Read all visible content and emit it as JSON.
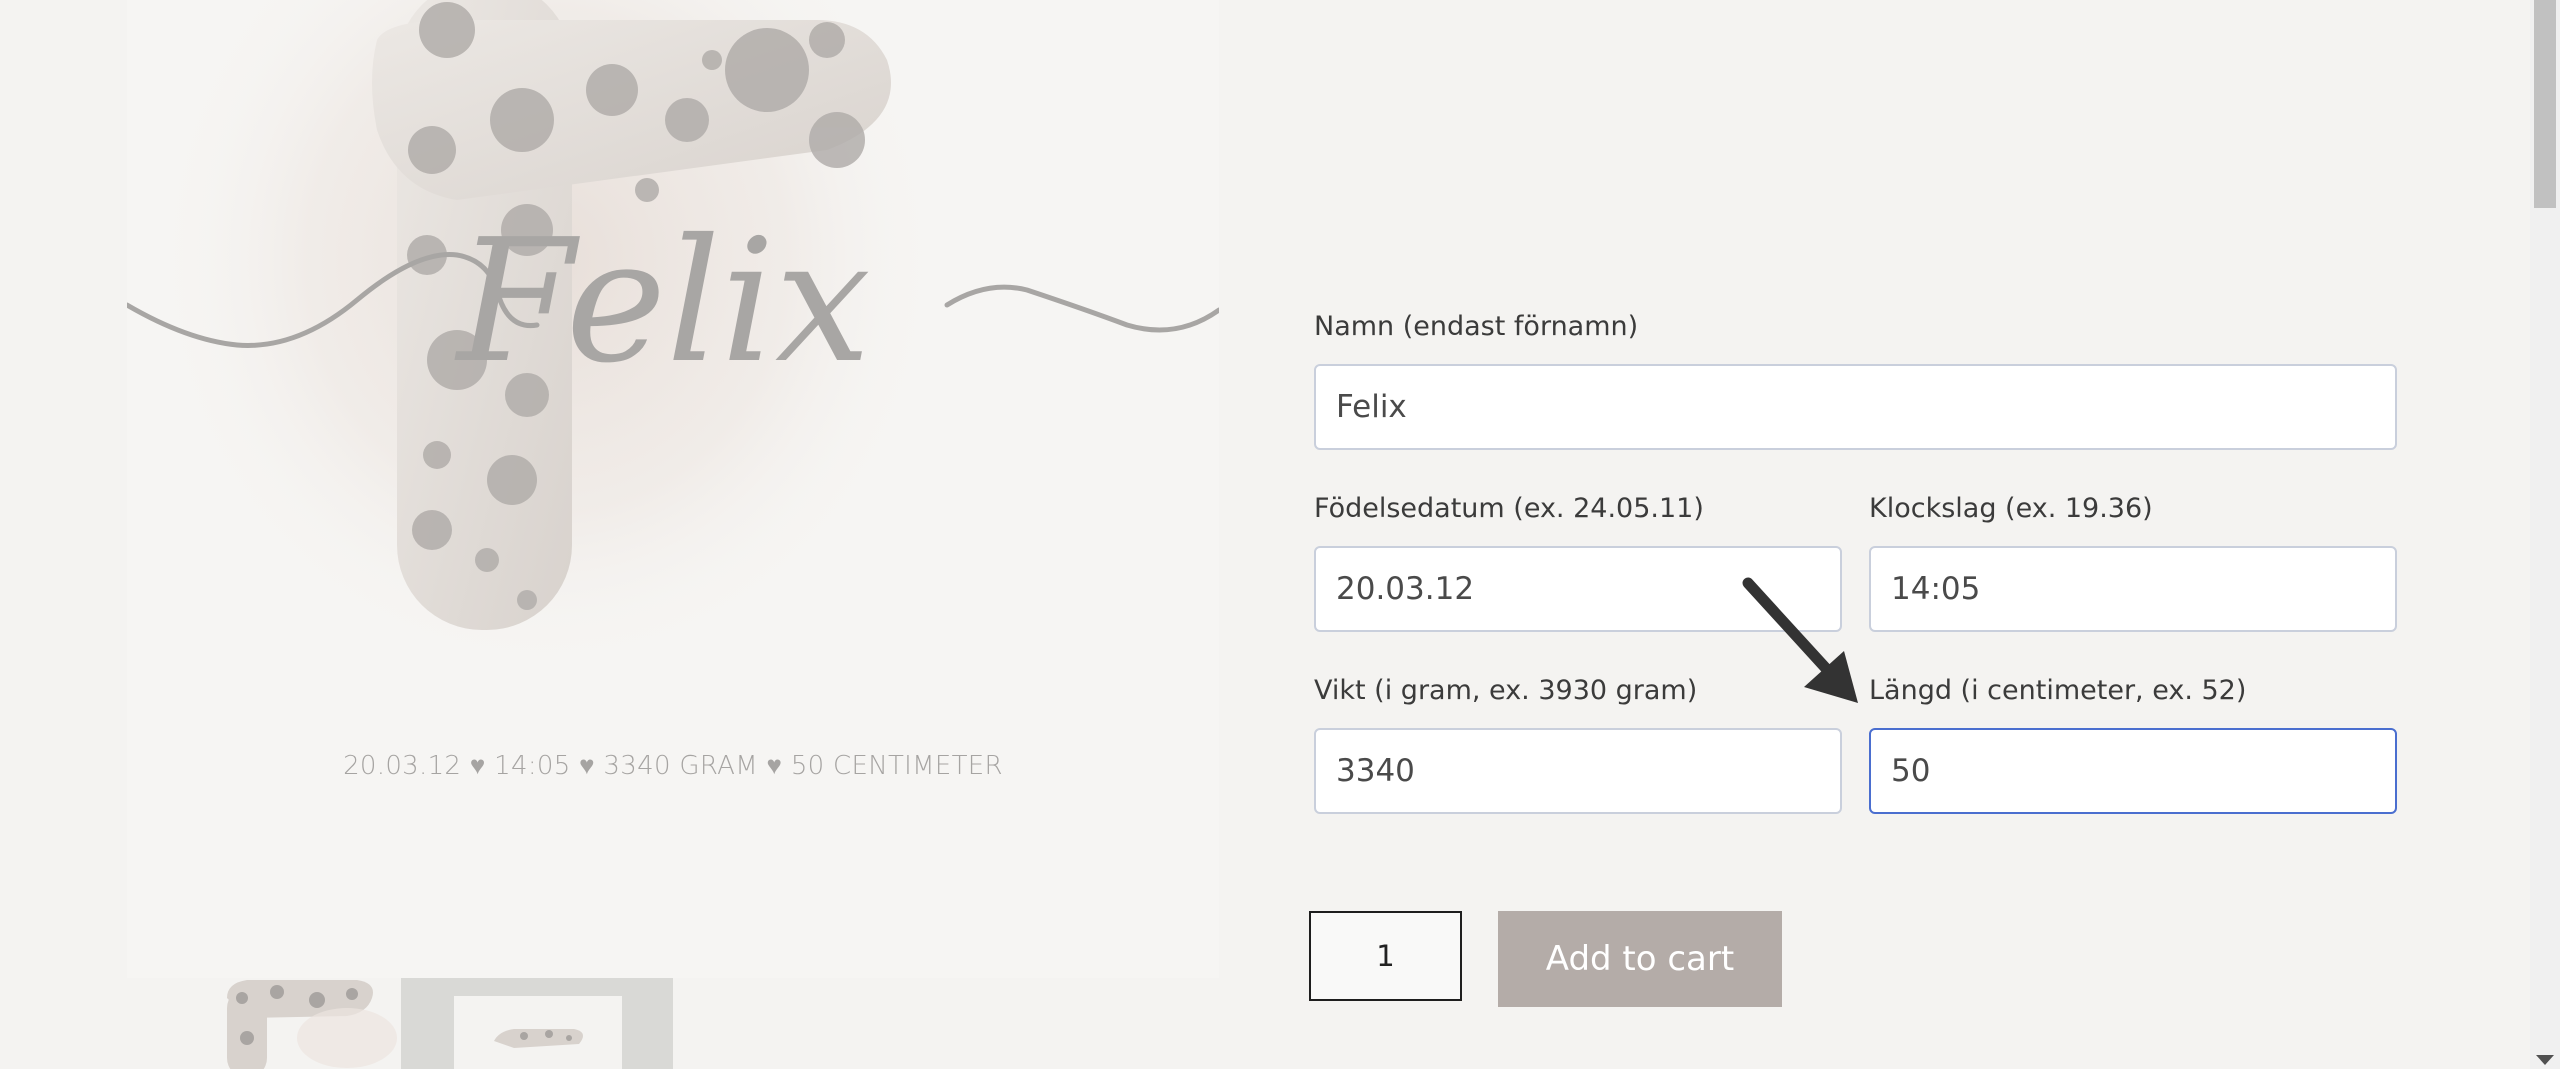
{
  "product_image": {
    "script_name": "Felix",
    "caption": "20.03.12 ♥ 14:05 ♥ 3340 GRAM ♥ 50 CENTIMETER"
  },
  "form": {
    "name": {
      "label": "Namn (endast förnamn)",
      "value": "Felix"
    },
    "birthdate": {
      "label": "Födelsedatum (ex. 24.05.11)",
      "value": "20.03.12"
    },
    "time": {
      "label": "Klockslag (ex. 19.36)",
      "value": "14:05"
    },
    "weight": {
      "label": "Vikt (i gram, ex. 3930 gram)",
      "value": "3340"
    },
    "length": {
      "label": "Längd (i centimeter, ex. 52)",
      "value": "50"
    },
    "quantity": "1",
    "add_to_cart_label": "Add to cart"
  },
  "colors": {
    "background": "#f4f3f1",
    "button": "#b4aca8",
    "focus_border": "#4a6ecf",
    "input_border": "#c9cfdc"
  }
}
